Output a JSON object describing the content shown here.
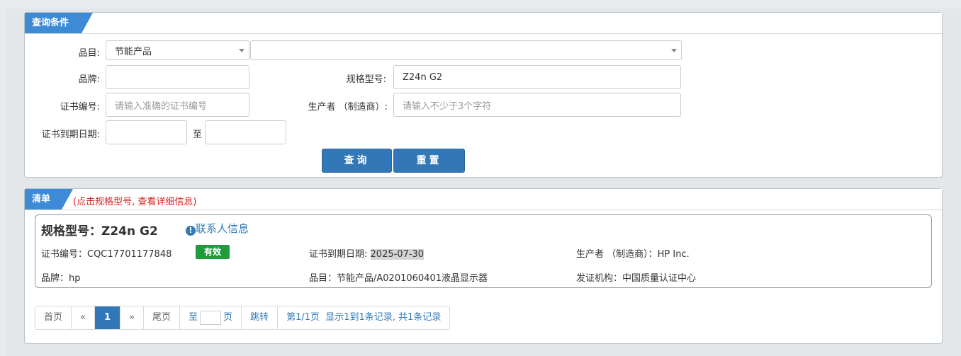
{
  "query_panel": {
    "tab_label": "查询条件",
    "category_label": "品目:",
    "category_value": "节能产品",
    "subcategory_value": "",
    "brand_label": "品牌:",
    "brand_value": "",
    "model_label": "规格型号:",
    "model_value": "Z24n G2",
    "cert_no_label": "证书编号:",
    "cert_no_placeholder": "请输入准确的证书编号",
    "maker_label": "生产者 （制造商）:",
    "maker_placeholder": "请输入不少于3个字符",
    "expiry_label": "证书到期日期:",
    "expiry_to": "至",
    "search_button": "查询",
    "reset_button": "重置"
  },
  "list_panel": {
    "tab_label": "清单",
    "hint": "(点击规格型号, 查看详细信息)",
    "result": {
      "title": "规格型号：Z24n G2",
      "contact_link": "联系人信息",
      "cert_no": "证书编号：CQC17701177848",
      "status": "有效",
      "expiry_label": "证书到期日期:",
      "expiry_value": "2025-07-30",
      "maker": "生产者 （制造商）：HP Inc.",
      "brand": "品牌：hp",
      "category": "品目：节能产品/A0201060401液晶显示器",
      "issuer": "发证机构：中国质量认证中心"
    },
    "pagination": {
      "first": "首页",
      "prev": "«",
      "current": "1",
      "next": "»",
      "last": "尾页",
      "goto_prefix": "至",
      "goto_suffix": "页",
      "jump": "跳转",
      "summary": "第1/1页  显示1到1条记录, 共1条记录"
    }
  },
  "colors": {
    "accent": "#3d8bd6",
    "button": "#3278b8",
    "valid_badge": "#1f9b3b",
    "hint_red": "#d9201f"
  }
}
